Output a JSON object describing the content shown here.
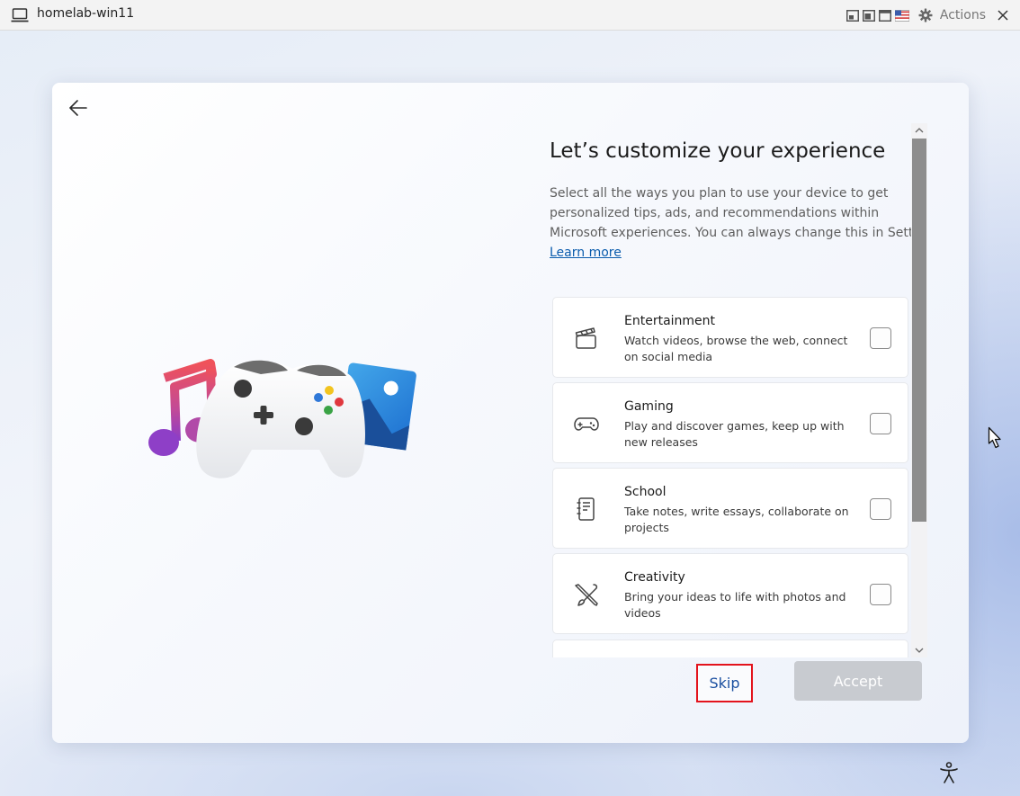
{
  "window": {
    "title": "homelab-win11",
    "actions_label": "Actions"
  },
  "oobe": {
    "heading": "Let’s customize your experience",
    "description_lines": [
      "Select all the ways you plan to use your device to get",
      "personalized tips, ads, and recommendations within",
      "Microsoft experiences. You can always change this in Settings."
    ],
    "learn_more": "Learn more",
    "options": [
      {
        "title": "Entertainment",
        "description": "Watch videos, browse the web, connect on social media",
        "icon": "clapperboard-icon",
        "checked": false
      },
      {
        "title": "Gaming",
        "description": "Play and discover games, keep up with new releases",
        "icon": "gamepad-icon",
        "checked": false
      },
      {
        "title": "School",
        "description": "Take notes, write essays, collaborate on projects",
        "icon": "notebook-icon",
        "checked": false
      },
      {
        "title": "Creativity",
        "description": "Bring your ideas to life with photos and videos",
        "icon": "pen-brush-icon",
        "checked": false
      }
    ],
    "skip_label": "Skip",
    "accept_label": "Accept"
  },
  "colors": {
    "highlight": "#e3131c",
    "link": "#0b5cad",
    "accept_disabled": "#c8cbd0"
  }
}
